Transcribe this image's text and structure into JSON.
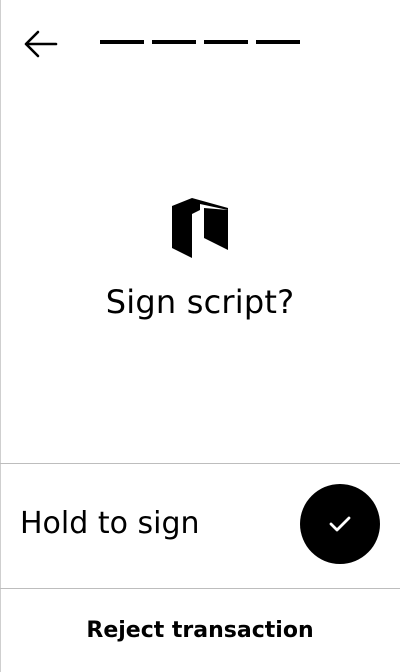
{
  "header": {
    "back_icon": "arrow-left-icon",
    "progress": {
      "total_steps": 4,
      "filled_steps": 4
    }
  },
  "content": {
    "app_icon": "neo-logo-icon",
    "title": "Sign script?"
  },
  "actions": {
    "hold_label": "Hold to sign",
    "confirm_icon": "checkmark-icon",
    "reject_label": "Reject transaction"
  },
  "colors": {
    "foreground": "#000000",
    "background": "#ffffff",
    "divider": "#bdbdbd"
  }
}
